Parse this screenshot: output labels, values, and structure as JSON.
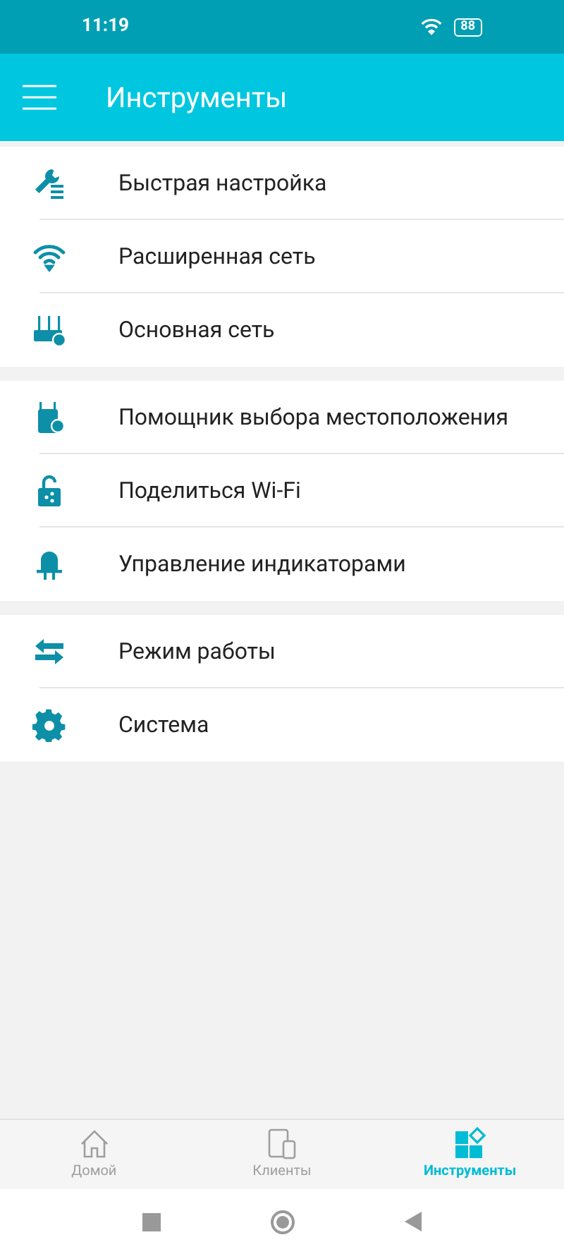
{
  "status_bar": {
    "time": "11:19",
    "battery": "88"
  },
  "app_bar": {
    "title": "Инструменты"
  },
  "sections": [
    {
      "items": [
        {
          "label": "Быстрая настройка"
        },
        {
          "label": "Расширенная сеть"
        },
        {
          "label": "Основная сеть"
        }
      ]
    },
    {
      "items": [
        {
          "label": "Помощник выбора местоположения"
        },
        {
          "label": "Поделиться Wi-Fi"
        },
        {
          "label": "Управление индикаторами"
        }
      ]
    },
    {
      "items": [
        {
          "label": "Режим работы"
        },
        {
          "label": "Система"
        }
      ]
    }
  ],
  "bottom_nav": [
    {
      "label": "Домой",
      "selected": false
    },
    {
      "label": "Клиенты",
      "selected": false
    },
    {
      "label": "Инструменты",
      "selected": true
    }
  ]
}
